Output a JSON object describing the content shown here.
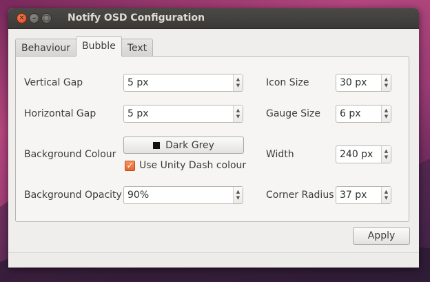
{
  "window": {
    "title": "Notify OSD Configuration"
  },
  "tabs": [
    {
      "label": "Behaviour",
      "active": false
    },
    {
      "label": "Bubble",
      "active": true
    },
    {
      "label": "Text",
      "active": false
    }
  ],
  "bubble": {
    "vertical_gap": {
      "label": "Vertical Gap",
      "value": "5 px"
    },
    "horizontal_gap": {
      "label": "Horizontal Gap",
      "value": "5 px"
    },
    "background_colour": {
      "label": "Background Colour",
      "value": "Dark Grey",
      "swatch_color": "#111111"
    },
    "use_unity_dash": {
      "label": "Use Unity Dash colour",
      "checked": true
    },
    "background_opacity": {
      "label": "Background Opacity",
      "value": "90%"
    },
    "icon_size": {
      "label": "Icon Size",
      "value": "30 px"
    },
    "gauge_size": {
      "label": "Gauge Size",
      "value": "6 px"
    },
    "width": {
      "label": "Width",
      "value": "240 px"
    },
    "corner_radius": {
      "label": "Corner Radius",
      "value": "37 px"
    }
  },
  "actions": {
    "apply_label": "Apply"
  },
  "colors": {
    "accent": "#e8652b",
    "window_bg": "#efeeec",
    "titlebar": "#3b3a36"
  }
}
